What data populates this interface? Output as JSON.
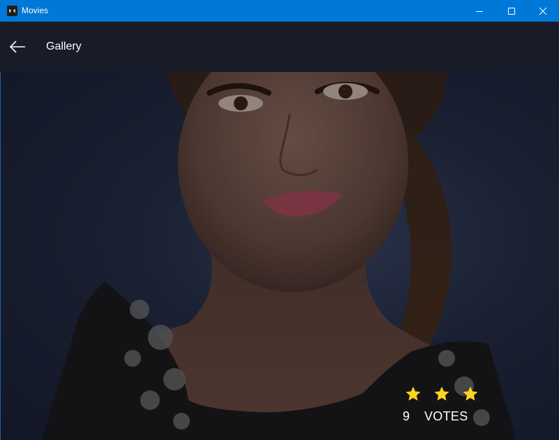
{
  "window": {
    "title": "Movies",
    "controls": [
      "minimize-icon",
      "maximize-icon",
      "close-icon"
    ],
    "accent_color": "#0078d7"
  },
  "header": {
    "back_icon": "arrow-left-icon",
    "title": "Gallery",
    "background": "#171c28"
  },
  "gallery": {
    "image_description_icon": "photo"
  },
  "rating": {
    "stars": 3,
    "star_color": "#ffd21f",
    "votes_count": "9",
    "votes_label": "VOTES"
  }
}
